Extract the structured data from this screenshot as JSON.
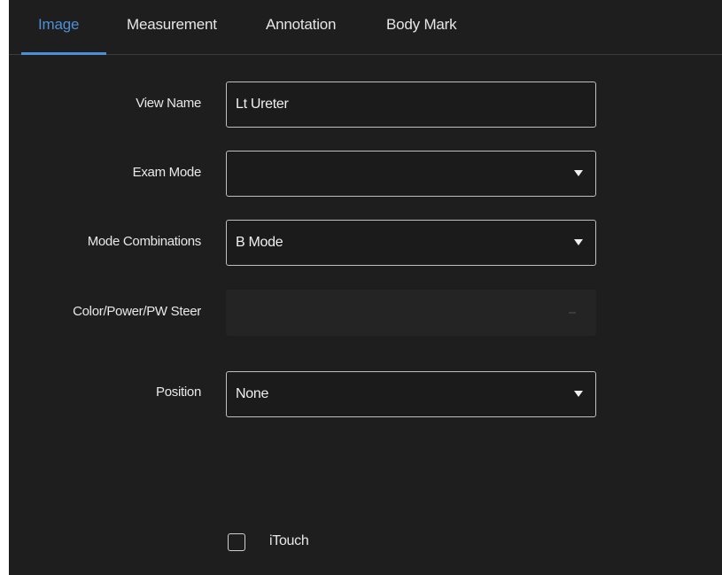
{
  "tabs": [
    {
      "label": "Image",
      "active": true
    },
    {
      "label": "Measurement",
      "active": false
    },
    {
      "label": "Annotation",
      "active": false
    },
    {
      "label": "Body Mark",
      "active": false
    }
  ],
  "form": {
    "view_name": {
      "label": "View Name",
      "value": "Lt Ureter"
    },
    "exam_mode": {
      "label": "Exam Mode",
      "value": ""
    },
    "mode_combinations": {
      "label": "Mode Combinations",
      "value": "B Mode"
    },
    "steer": {
      "label": "Color/Power/PW Steer",
      "value": "",
      "enabled": false
    },
    "position": {
      "label": "Position",
      "value": "None"
    },
    "itouch": {
      "label": "iTouch",
      "checked": false
    }
  },
  "colors": {
    "background": "#1e1e1f",
    "accent": "#4f8fd6",
    "text": "#e8e8e8",
    "field_border": "#bfbfbf"
  }
}
